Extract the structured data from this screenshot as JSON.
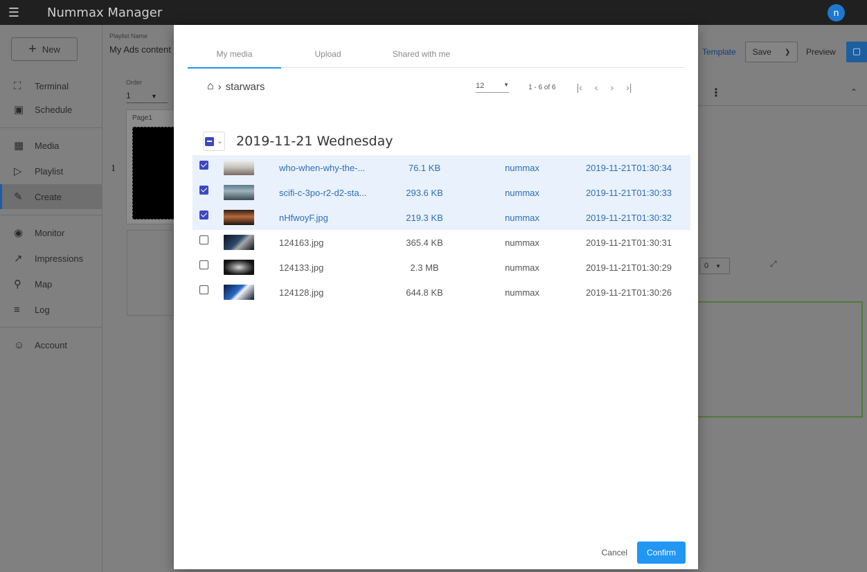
{
  "app": {
    "title": "Nummax Manager",
    "avatar_letter": "n"
  },
  "sidebar": {
    "new_label": "New",
    "items": [
      {
        "label": "Terminal",
        "icon": "cast-icon"
      },
      {
        "label": "Schedule",
        "icon": "calendar-icon"
      },
      {
        "label": "Media",
        "icon": "image-icon"
      },
      {
        "label": "Playlist",
        "icon": "playlist-icon"
      },
      {
        "label": "Create",
        "icon": "pencil-icon",
        "active": true
      },
      {
        "label": "Monitor",
        "icon": "eye-icon"
      },
      {
        "label": "Impressions",
        "icon": "trending-icon"
      },
      {
        "label": "Map",
        "icon": "pin-icon"
      },
      {
        "label": "Log",
        "icon": "list-icon"
      },
      {
        "label": "Account",
        "icon": "user-icon"
      }
    ]
  },
  "editor": {
    "playlist_name_label": "Playlist Name",
    "playlist_name_value": "My Ads content",
    "order_label": "Order",
    "order_value": "1",
    "page_label": "Page1",
    "row_number": "1",
    "template_label": "Template",
    "save_label": "Save",
    "preview_label": "Preview",
    "select_value": "0"
  },
  "modal": {
    "tabs": [
      "My media",
      "Upload",
      "Shared with me"
    ],
    "active_tab": "My media",
    "breadcrumb": "starwars",
    "per_page": "12",
    "range_text": "1 - 6 of 6",
    "group_title": "2019-11-21 Wednesday",
    "rows": [
      {
        "name": "who-when-why-the-...",
        "size": "76.1 KB",
        "owner": "nummax",
        "date": "2019-11-21T01:30:34",
        "selected": true
      },
      {
        "name": "scifi-c-3po-r2-d2-sta...",
        "size": "293.6 KB",
        "owner": "nummax",
        "date": "2019-11-21T01:30:33",
        "selected": true
      },
      {
        "name": "nHfwoyF.jpg",
        "size": "219.3 KB",
        "owner": "nummax",
        "date": "2019-11-21T01:30:32",
        "selected": true
      },
      {
        "name": "124163.jpg",
        "size": "365.4 KB",
        "owner": "nummax",
        "date": "2019-11-21T01:30:31",
        "selected": false
      },
      {
        "name": "124133.jpg",
        "size": "2.3 MB",
        "owner": "nummax",
        "date": "2019-11-21T01:30:29",
        "selected": false
      },
      {
        "name": "124128.jpg",
        "size": "644.8 KB",
        "owner": "nummax",
        "date": "2019-11-21T01:30:26",
        "selected": false
      }
    ],
    "cancel_label": "Cancel",
    "confirm_label": "Confirm"
  },
  "colors": {
    "accent": "#2196f3",
    "selected_row": "#e9f1fc",
    "checkbox": "#3b48c4",
    "topbar": "#202020"
  }
}
